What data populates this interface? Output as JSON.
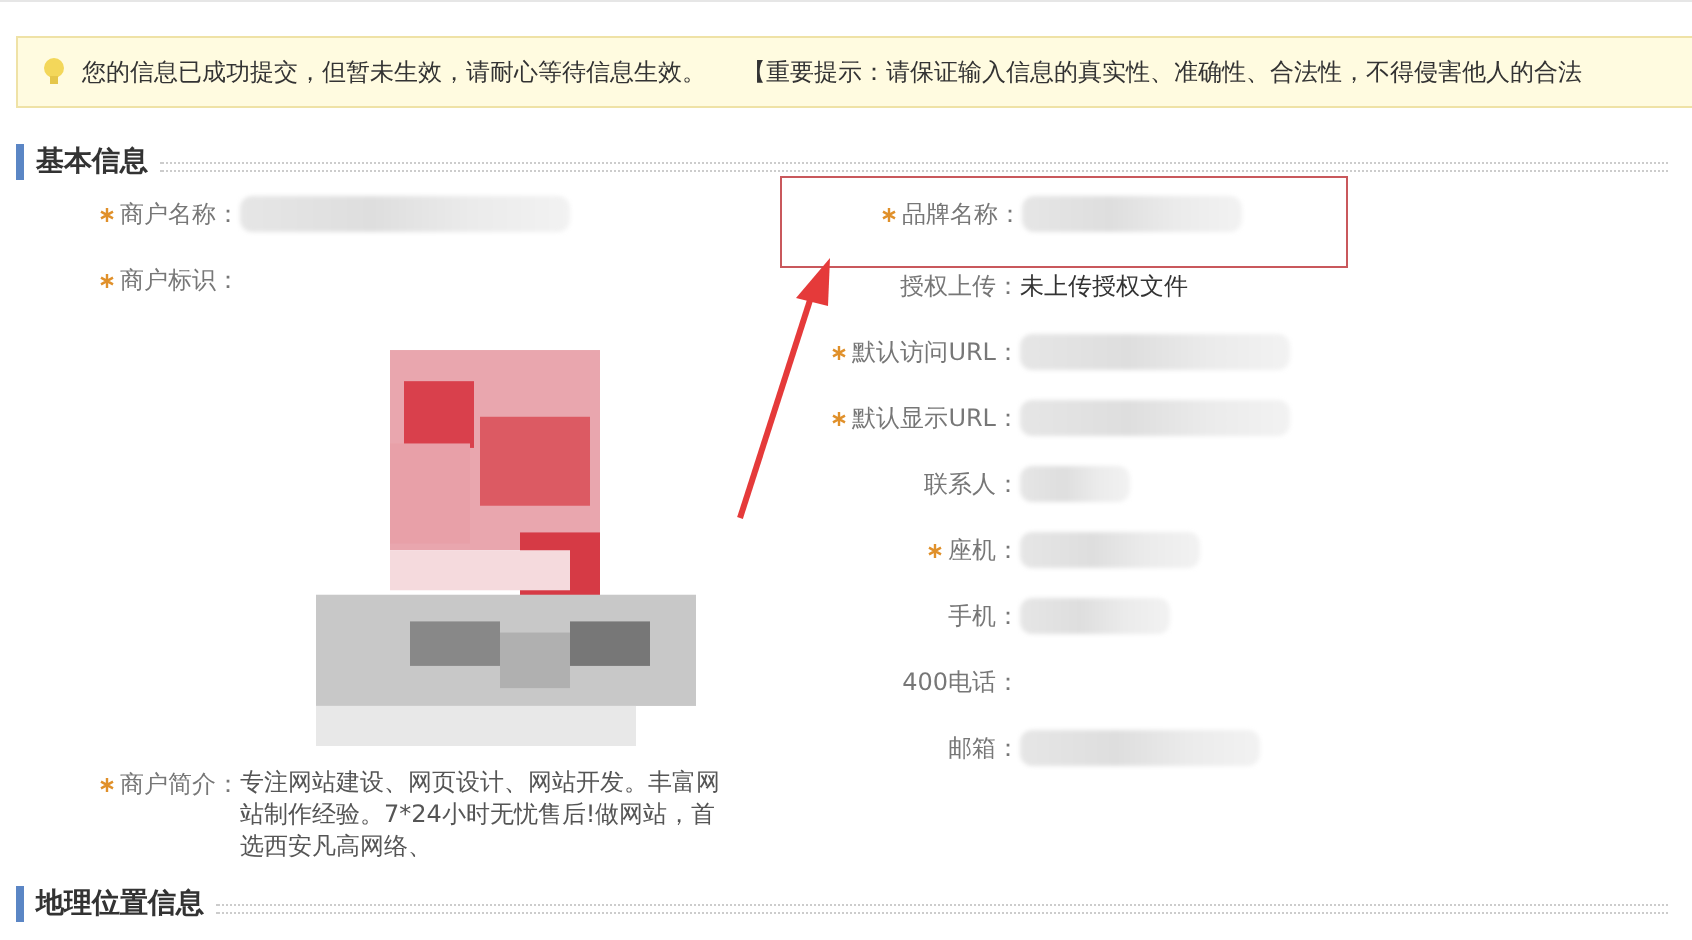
{
  "notice": {
    "message": "您的信息已成功提交，但暂未生效，请耐心等待信息生效。",
    "tip": "【重要提示：请保证输入信息的真实性、准确性、合法性，不得侵害他人的合法"
  },
  "basic_info": {
    "title": "基本信息",
    "left_fields": [
      {
        "kind": "blurred",
        "label": "商户名称：",
        "required": true
      },
      {
        "label": "商户标识：",
        "required": true
      },
      {
        "kind": "text",
        "label": "商户简介：",
        "required": true,
        "value": "专注网站建设、网页设计、网站开发。丰富网站制作经验。7*24小时无忧售后!做网站，首选西安凡高网络、"
      }
    ],
    "right_fields": [
      {
        "kind": "blurred",
        "label": "品牌名称：",
        "required": true,
        "highlighted": true
      },
      {
        "kind": "text",
        "label": "授权上传：",
        "required": false,
        "highlighted": false,
        "value": "未上传授权文件"
      },
      {
        "kind": "blurred",
        "label": "默认访问URL：",
        "required": true,
        "highlighted": false
      },
      {
        "kind": "blurred",
        "label": "默认显示URL：",
        "required": true,
        "highlighted": false
      },
      {
        "kind": "blurred",
        "label": "联系人：",
        "required": false,
        "highlighted": false
      },
      {
        "kind": "blurred",
        "label": "座机：",
        "required": true,
        "highlighted": false
      },
      {
        "kind": "blurred",
        "label": "手机：",
        "required": false,
        "highlighted": false
      },
      {
        "kind": "empty",
        "label": "400电话：",
        "required": false,
        "highlighted": false
      },
      {
        "kind": "blurred",
        "label": "邮箱：",
        "required": false,
        "highlighted": false
      }
    ]
  },
  "location_info": {
    "title": "地理位置信息"
  }
}
